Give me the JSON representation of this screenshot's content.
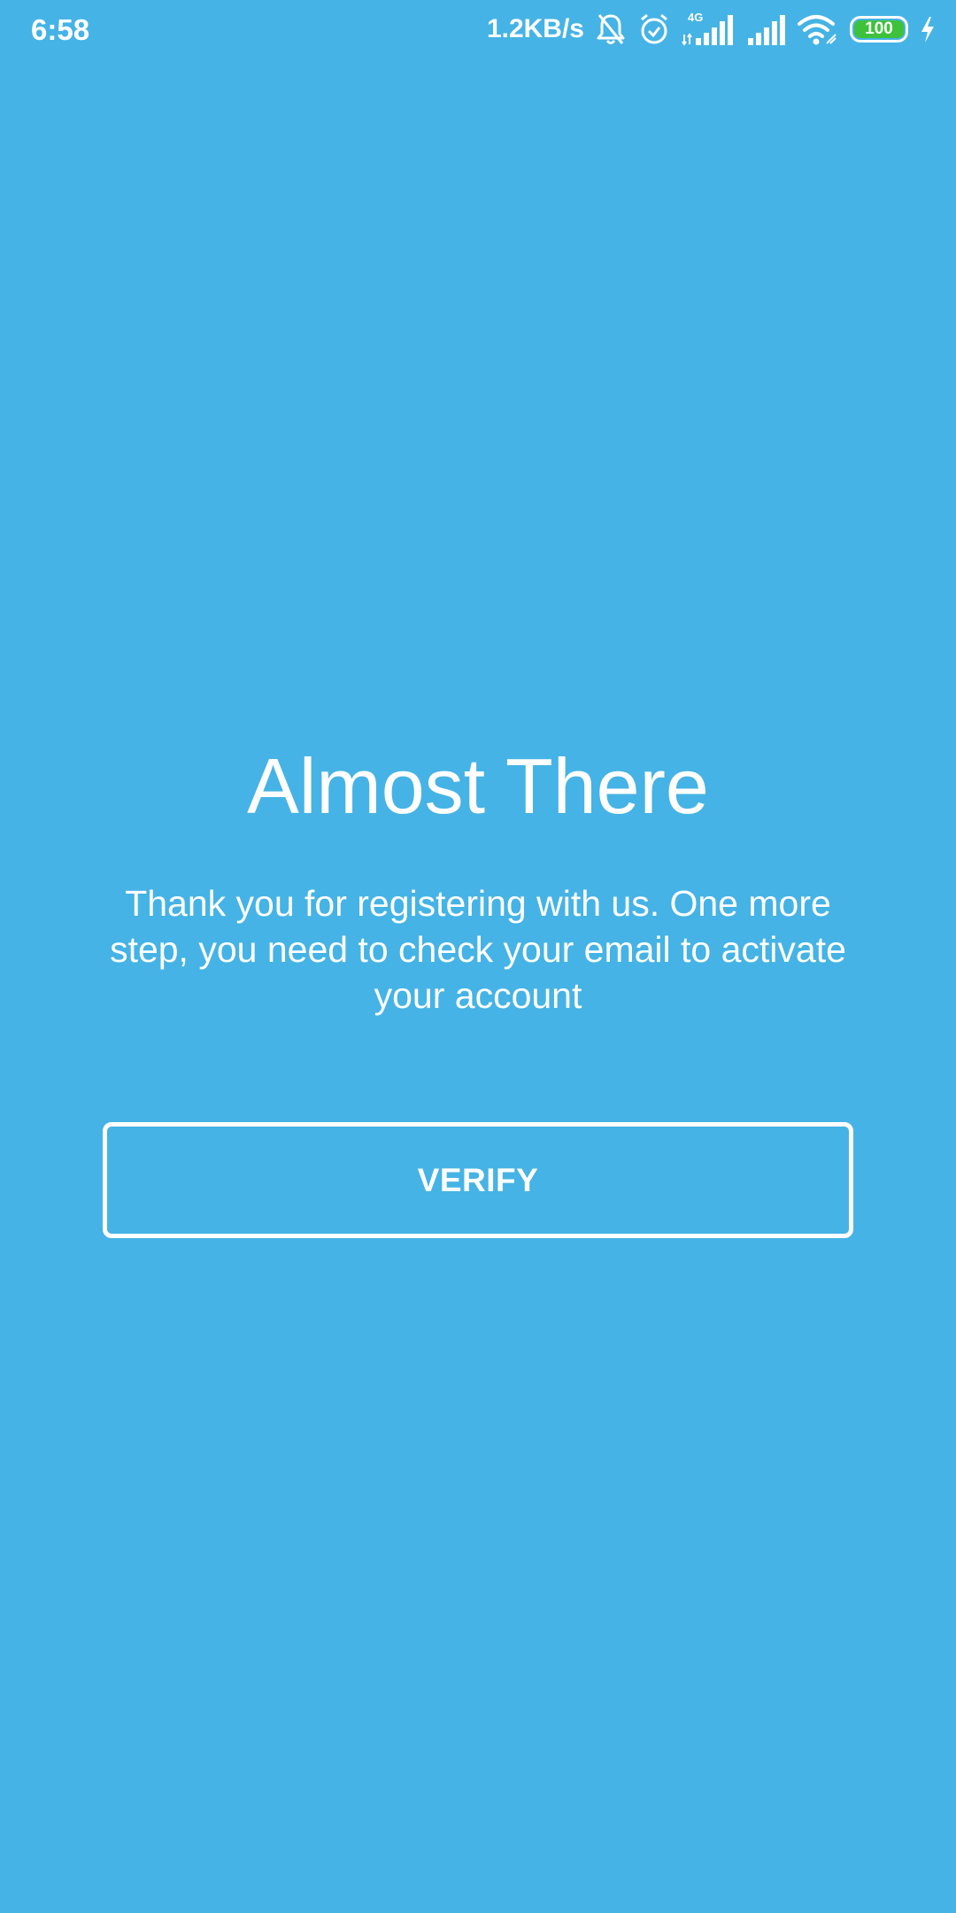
{
  "status_bar": {
    "time": "6:58",
    "net_speed": "1.2KB/s",
    "network_type": "4G",
    "battery_level": "100",
    "icons": [
      "bell-muted-icon",
      "alarm-icon",
      "signal-4g-icon",
      "signal-icon",
      "wifi-icon",
      "battery-icon",
      "charging-icon"
    ],
    "battery_color": "#3EC23B"
  },
  "screen": {
    "background_color": "#45B3E5",
    "title": "Almost There",
    "message": "Thank you for registering with us. One more step, you need to check your email to activate your account",
    "verify_button_label": "VERIFY"
  }
}
